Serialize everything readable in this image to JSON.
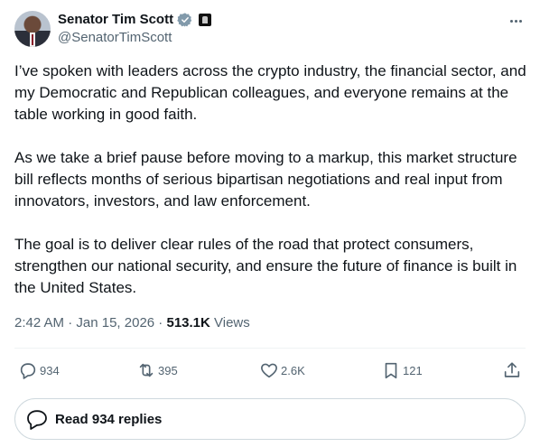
{
  "author": {
    "display_name": "Senator Tim Scott",
    "handle": "@SenatorTimScott",
    "verified_color": "#829aab"
  },
  "tweet": {
    "paragraphs": [
      "I’ve spoken with leaders across the crypto industry, the financial sector, and my Democratic and Republican colleagues, and everyone remains at the table working in good faith.",
      "As we take a brief pause before moving to a markup, this market structure bill reflects months of serious bipartisan negotiations and real input from innovators, investors, and law enforcement.",
      "The goal is to deliver clear rules of the road that protect consumers, strengthen our national security, and ensure the future of finance is built in the United States."
    ]
  },
  "meta": {
    "time": "2:42 AM",
    "sep1": " · ",
    "date": "Jan 15, 2026",
    "sep2": " · ",
    "views_count": "513.1K",
    "views_label": " Views"
  },
  "actions": {
    "replies": "934",
    "reposts": "395",
    "likes": "2.6K",
    "bookmarks": "121"
  },
  "read_replies_label": "Read 934 replies"
}
